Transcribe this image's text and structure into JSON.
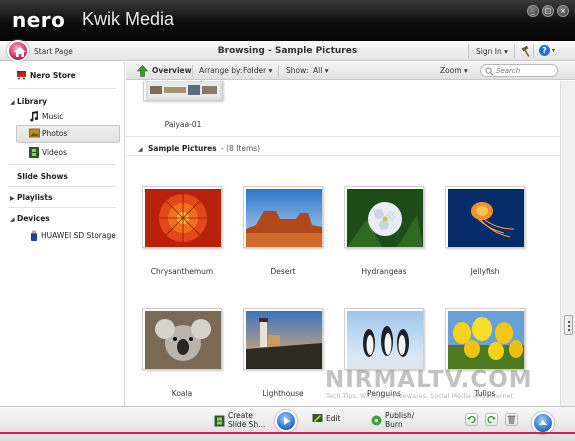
{
  "window": {
    "brand": "nero",
    "product": "Kwik Media",
    "controls": [
      "_",
      "□",
      "×"
    ]
  },
  "nav": {
    "start_page": "Start Page",
    "title": "Browsing - Sample Pictures",
    "sign_in": "Sign In",
    "help": "?"
  },
  "sidebar": {
    "store": "Nero Store",
    "library": "Library",
    "music": "Music",
    "photos": "Photos",
    "videos": "Videos",
    "slide_shows": "Slide Shows",
    "playlists": "Playlists",
    "devices": "Devices",
    "device_name": "HUAWEI SD Storage"
  },
  "toolbar": {
    "overview": "Overview",
    "arrange_label": "Arrange by:",
    "arrange_value": "Folder",
    "show_label": "Show:",
    "show_value": "All",
    "zoom": "Zoom",
    "search_placeholder": "Search"
  },
  "content": {
    "prev_item": "Paiyaa-01",
    "section_name": "Sample Pictures",
    "section_count": "- (8 Items)",
    "items": [
      "Chrysanthemum",
      "Desert",
      "Hydrangeas",
      "Jellyfish",
      "Koala",
      "Lighthouse",
      "Penguins",
      "Tulips"
    ]
  },
  "bottom": {
    "create_l1": "Create",
    "create_l2": "Slide Sh...",
    "edit": "Edit",
    "publish_l1": "Publish/",
    "publish_l2": "Burn"
  },
  "watermark": {
    "main": "NIRMALTV.COM",
    "sub": "Tech Tips, Windows, Freewares, Social Media and Internet"
  },
  "colors": {
    "accent_pink": "#d11f5e",
    "accent_blue": "#2a6fc9",
    "titlebar": "#0d0d0d"
  }
}
